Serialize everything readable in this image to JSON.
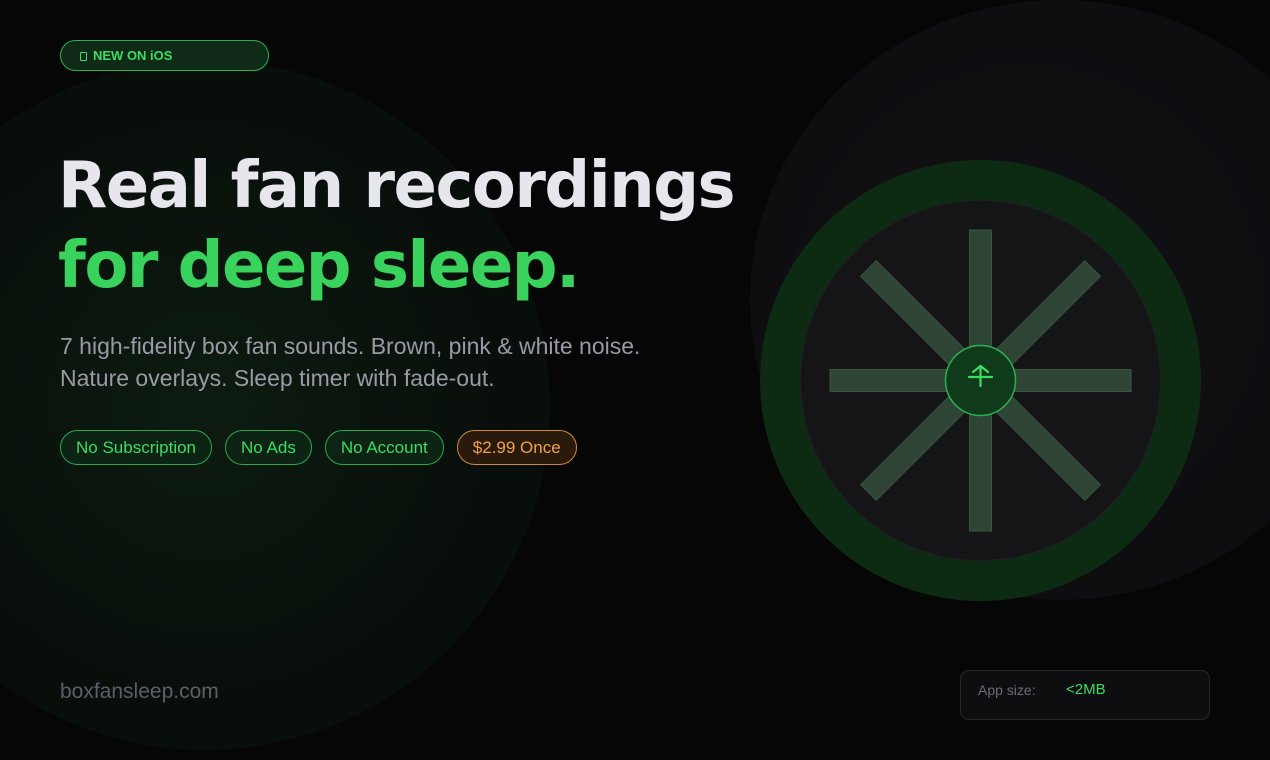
{
  "badge": {
    "icon": "phone-icon",
    "text": "NEW ON iOS"
  },
  "headline": {
    "line1": "Real fan recordings",
    "line2": "for deep sleep."
  },
  "subtext": {
    "line1": "7 high-fidelity box fan sounds. Brown, pink & white noise.",
    "line2": "Nature overlays. Sleep timer with fade-out."
  },
  "pills": [
    {
      "label": "No Subscription"
    },
    {
      "label": "No Ads"
    },
    {
      "label": "No Account"
    },
    {
      "label": "$2.99 Once"
    }
  ],
  "footer": {
    "site": "boxfansleep.com"
  },
  "size_card": {
    "label": "App size:",
    "value": "<2MB"
  },
  "fan": {
    "icon": "fan-icon",
    "hub_icon": "fan-hub-icon"
  },
  "colors": {
    "background": "#060607",
    "accent_green": "#38d25c",
    "price_orange": "#f0a24a",
    "headline_text": "#e6e6ec",
    "muted_text": "#9a9aa6"
  }
}
